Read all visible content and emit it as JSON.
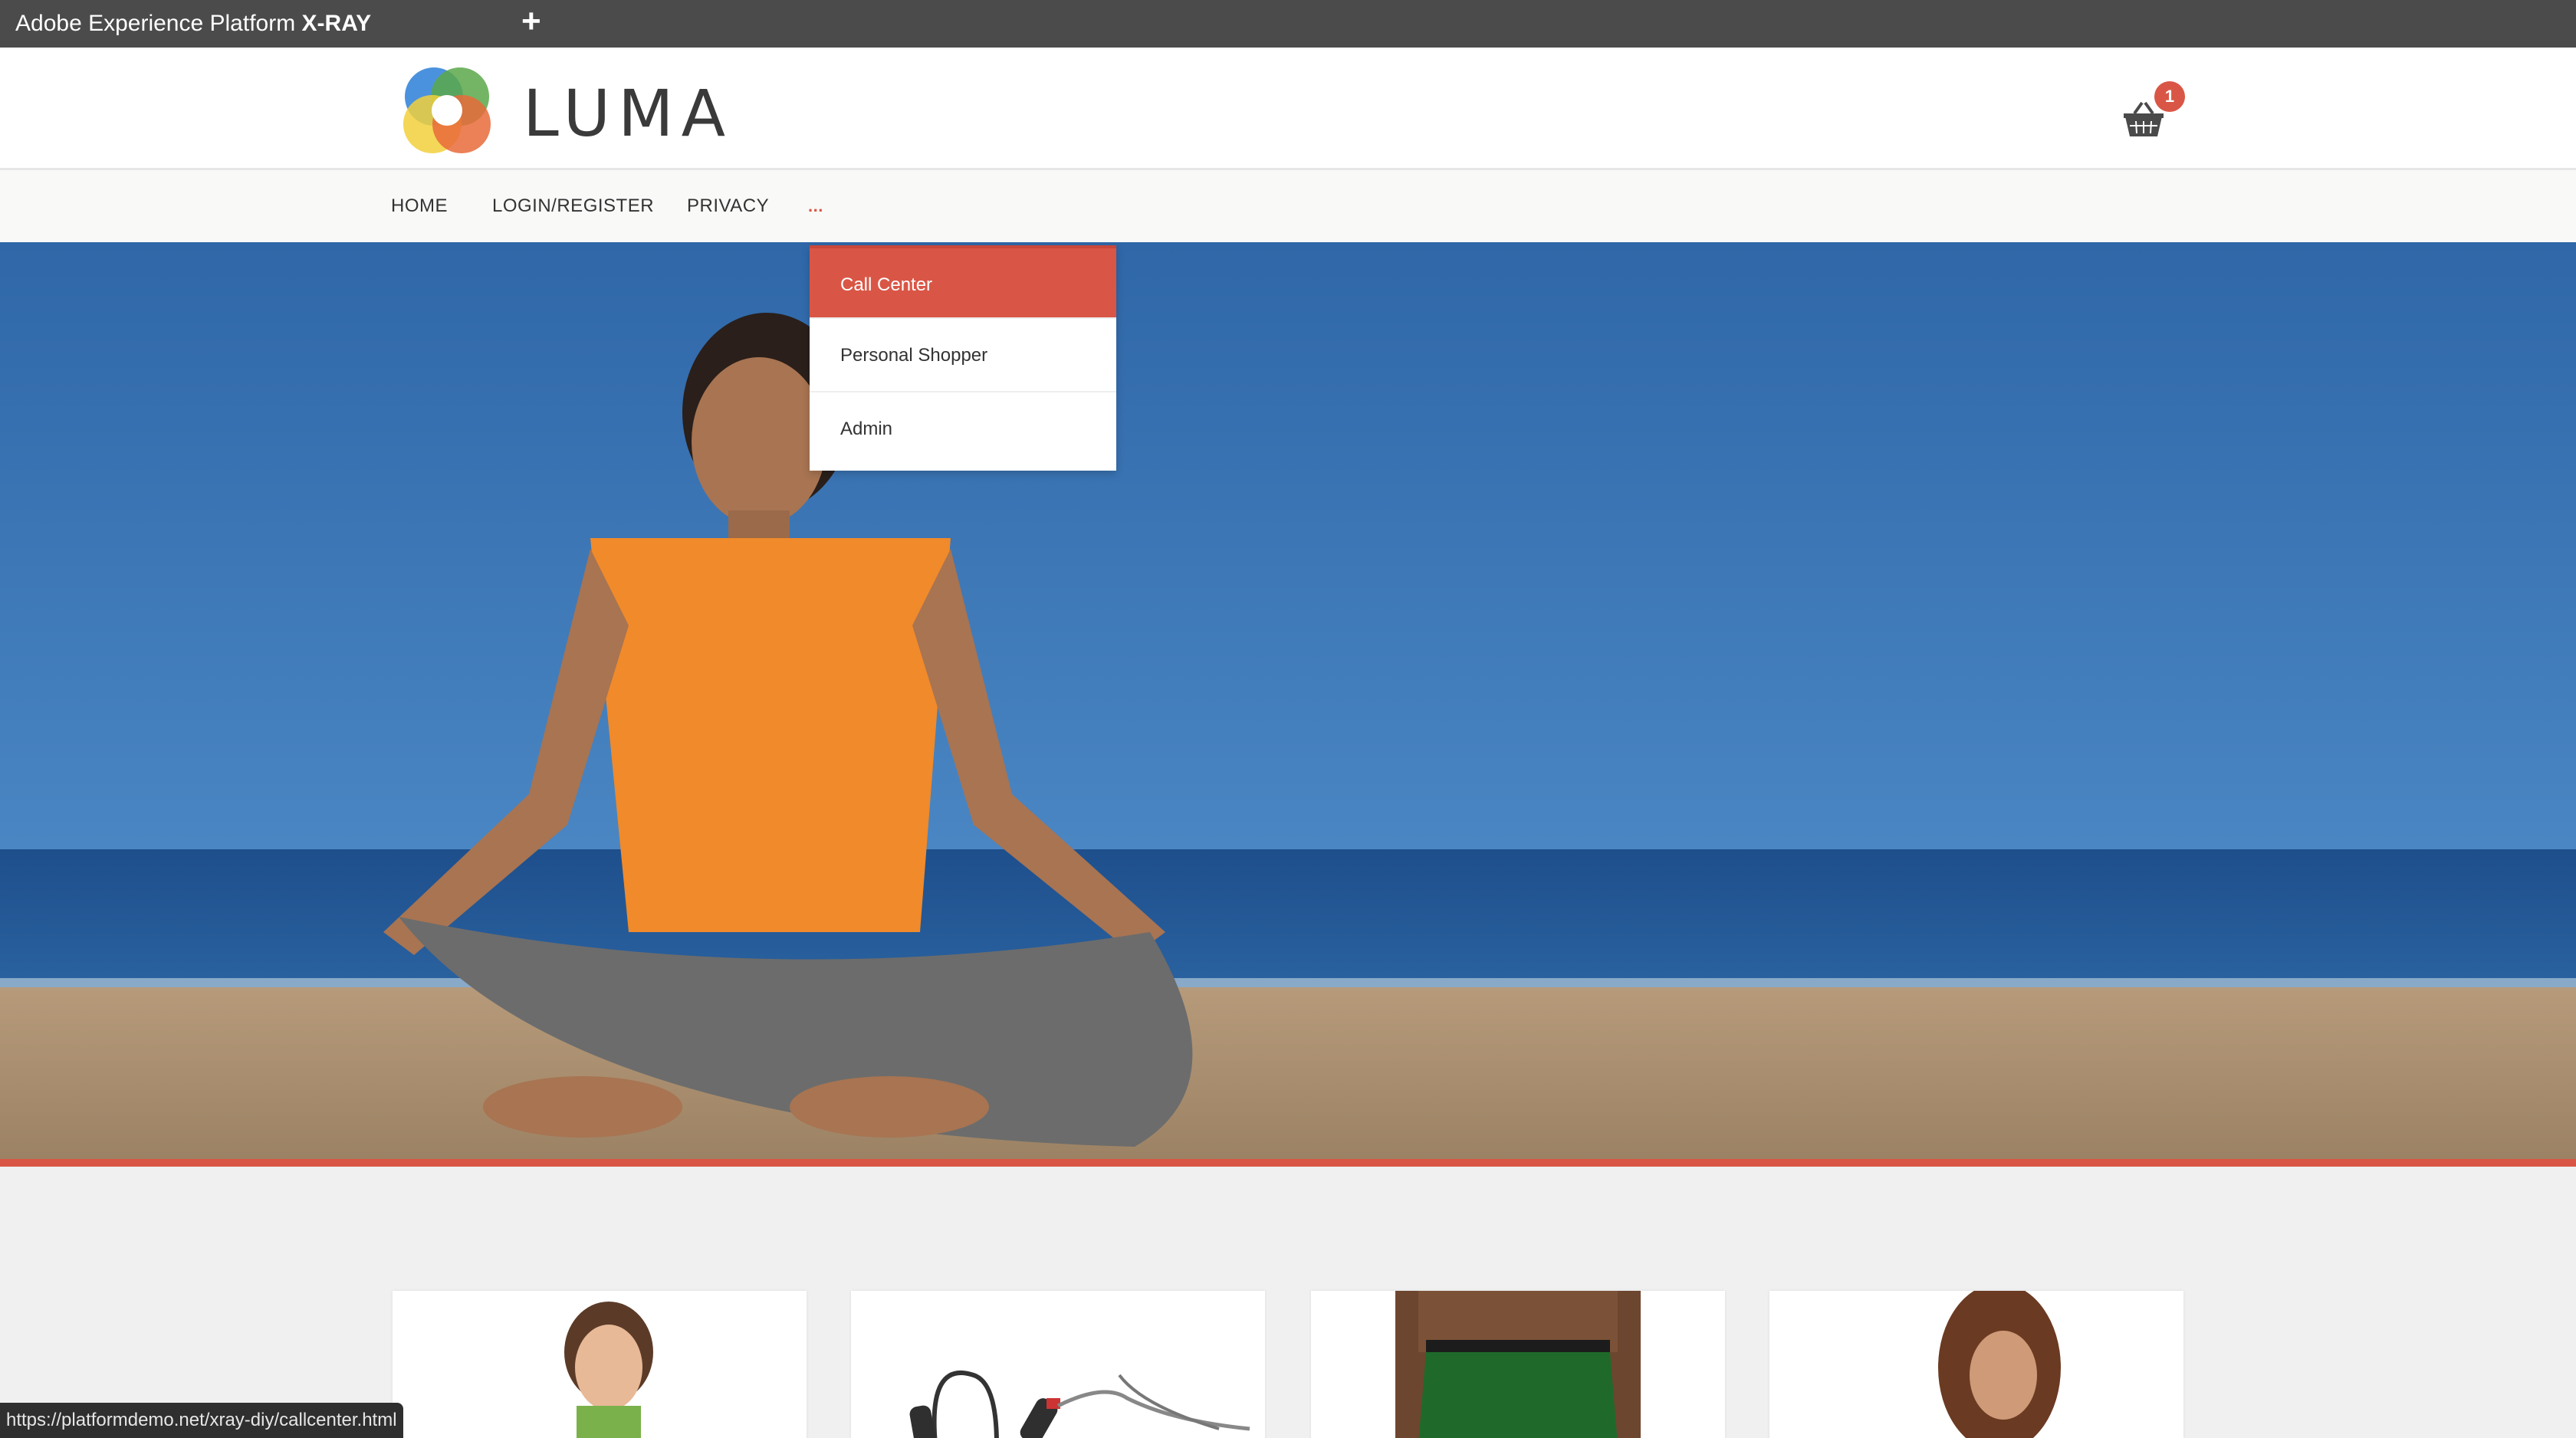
{
  "xray": {
    "title_prefix": "Adobe Experience Platform",
    "title_emphasis": "X-RAY",
    "add_label": "+"
  },
  "header": {
    "brand": "LUMA",
    "cart_count": "1",
    "logo_icon": "luma-logo",
    "cart_icon": "basket-icon"
  },
  "nav": {
    "items": [
      {
        "label": "HOME"
      },
      {
        "label": "LOGIN/REGISTER"
      },
      {
        "label": "PRIVACY"
      },
      {
        "label": "..."
      }
    ]
  },
  "dropdown": {
    "items": [
      {
        "label": "Call Center",
        "active": true
      },
      {
        "label": "Personal Shopper",
        "active": false
      },
      {
        "label": "Admin",
        "active": false
      }
    ]
  },
  "products": [
    {
      "image": "woman-portrait-thumbnail"
    },
    {
      "image": "jump-rope-thumbnail"
    },
    {
      "image": "green-shorts-thumbnail"
    },
    {
      "image": "woman-portrait-thumbnail"
    }
  ],
  "status_bar": {
    "url": "https://platformdemo.net/xray-diy/callcenter.html"
  },
  "colors": {
    "accent": "#d95646",
    "topbar": "#4b4b4b",
    "nav_bg": "#f9f9f8",
    "page_bg": "#f0f0f0"
  }
}
